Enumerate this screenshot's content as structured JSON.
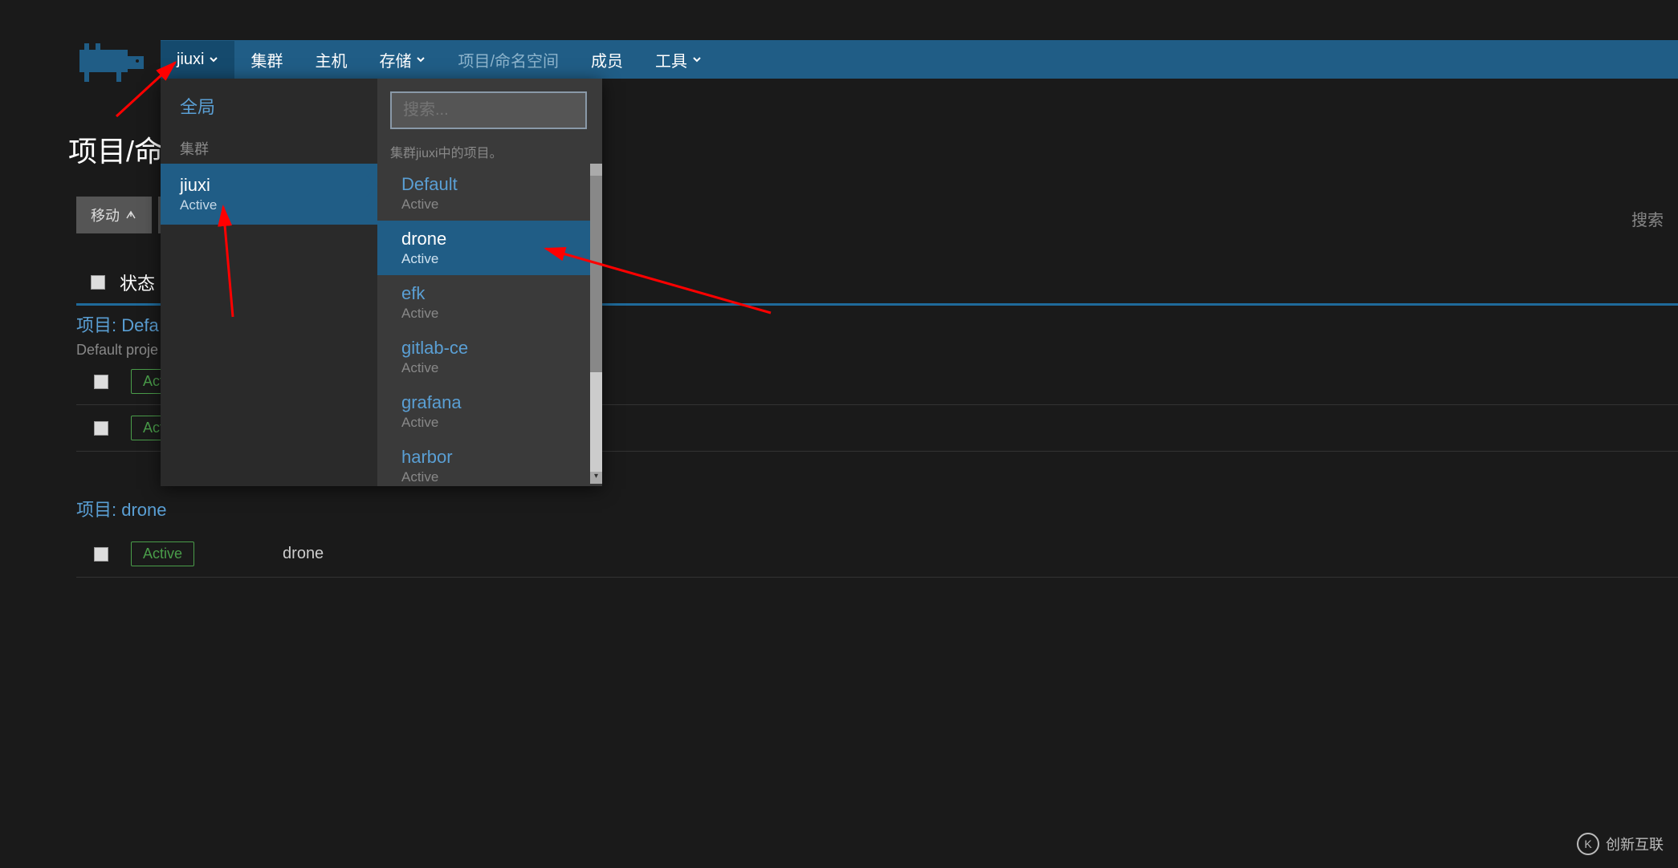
{
  "nav": {
    "cluster_selector": "jiuxi",
    "items": {
      "cluster": "集群",
      "host": "主机",
      "storage": "存储",
      "project_ns": "项目/命名空间",
      "members": "成员",
      "tools": "工具"
    }
  },
  "page": {
    "title_partial": "项目/命名",
    "move_btn": "移动",
    "search_label": "搜索",
    "status_col": "状态"
  },
  "dropdown": {
    "global": "全局",
    "cluster_label": "集群",
    "search_placeholder": "搜索...",
    "projects_note": "集群jiuxi中的项目。",
    "clusters": [
      {
        "name": "jiuxi",
        "status": "Active",
        "active": true
      }
    ],
    "projects": [
      {
        "name": "Default",
        "status": "Active",
        "hover": false
      },
      {
        "name": "drone",
        "status": "Active",
        "hover": true
      },
      {
        "name": "efk",
        "status": "Active",
        "hover": false
      },
      {
        "name": "gitlab-ce",
        "status": "Active",
        "hover": false
      },
      {
        "name": "grafana",
        "status": "Active",
        "hover": false
      },
      {
        "name": "harbor",
        "status": "Active",
        "hover": false
      }
    ]
  },
  "sections": [
    {
      "title": "项目: Defa",
      "desc": "Default proje",
      "rows": [
        {
          "status": "Active",
          "name": ""
        },
        {
          "status": "Active",
          "name": ""
        }
      ]
    },
    {
      "title": "项目: drone",
      "desc": "",
      "rows": [
        {
          "status": "Active",
          "name": "drone"
        }
      ]
    }
  ],
  "watermark": "创新互联"
}
